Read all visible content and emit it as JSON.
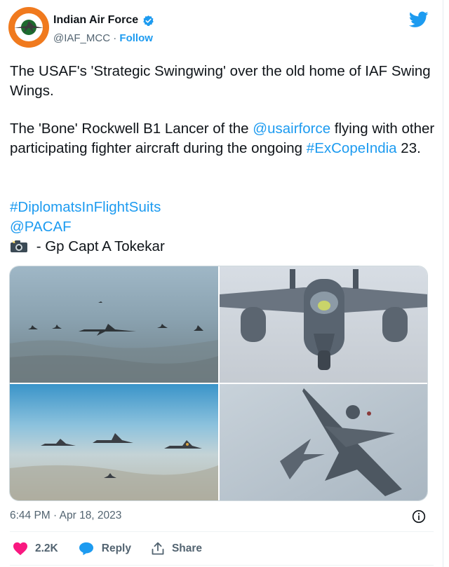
{
  "account": {
    "name": "Indian Air Force",
    "handle": "@IAF_MCC",
    "separator": " · ",
    "follow_label": "Follow",
    "avatar_icon": "iaf-roundel-icon",
    "verified_icon": "verified-badge-icon",
    "brand_icon": "twitter-bird-icon"
  },
  "tweet": {
    "line1": "The USAF's 'Strategic Swingwing' over the old home of IAF Swing Wings.",
    "line2_prefix": "The 'Bone' Rockwell B1 Lancer of the ",
    "mention_usaf": "@usairforce",
    "line2_middle": " flying with other participating fighter aircraft during the ongoing ",
    "hashtag_excope": "#ExCopeIndia",
    "line2_suffix": " 23.",
    "hashtag_diplomats": "#DiplomatsInFlightSuits",
    "mention_pacaf": "@PACAF",
    "credit_icon": "camera-flash-icon",
    "credit_text": " - Gp Capt A Tokekar"
  },
  "media": {
    "images": [
      {
        "name": "b1-formation-photo"
      },
      {
        "name": "f15-closeup-photo"
      },
      {
        "name": "fighters-formation-photo"
      },
      {
        "name": "rafale-banking-photo"
      }
    ]
  },
  "meta": {
    "timestamp": "6:44 PM · Apr 18, 2023",
    "info_icon": "info-icon"
  },
  "actions": {
    "like_count": "2.2K",
    "reply_label": "Reply",
    "share_label": "Share"
  },
  "colors": {
    "link": "#1d9bf0",
    "like": "#f91880",
    "text": "#0f1419",
    "muted": "#536471"
  }
}
